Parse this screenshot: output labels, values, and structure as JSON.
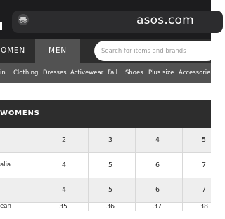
{
  "browser": {
    "url": "asos.com",
    "site_icon": "incognito-icon"
  },
  "nav": {
    "tabs": [
      {
        "label": "WOMEN",
        "visible": "OMEN"
      },
      {
        "label": "MEN"
      }
    ],
    "search_placeholder": "Search for items and brands"
  },
  "categories": [
    "in",
    "Clothing",
    "Dresses",
    "Activewear",
    "Fall",
    "Shoes",
    "Plus size",
    "Accessories"
  ],
  "size_table": {
    "title": "WOMENS",
    "rows": [
      {
        "label": "",
        "values": [
          "2",
          "3",
          "4",
          "5"
        ]
      },
      {
        "label": "alia",
        "values": [
          "4",
          "5",
          "6",
          "7"
        ]
      },
      {
        "label": "",
        "values": [
          "4",
          "5",
          "6",
          "7"
        ]
      },
      {
        "label": "ean",
        "values": [
          "35",
          "36",
          "37",
          "38"
        ]
      }
    ]
  },
  "colors": {
    "browser_bar": "#1c1c1e",
    "nav_bg": "#2d2d2d",
    "active_tab": "#525252",
    "category_strip": "#525252",
    "row_shade": "#eeeeee"
  }
}
